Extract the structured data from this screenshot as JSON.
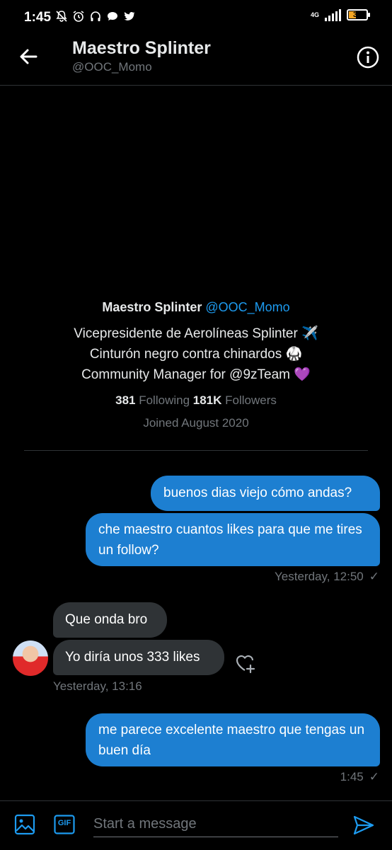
{
  "status_bar": {
    "time": "1:45",
    "network": "4G",
    "battery": "39",
    "icons": [
      "mute-icon",
      "alarm-icon",
      "headphones-icon",
      "chat-bubble-icon",
      "twitter-icon"
    ]
  },
  "header": {
    "name": "Maestro Splinter",
    "handle": "@OOC_Momo"
  },
  "profile": {
    "name": "Maestro Splinter",
    "handle": "@OOC_Momo",
    "bio": [
      "Vicepresidente de Aerolíneas Splinter ✈️",
      "Cinturón negro contra chinardos 🥋",
      "Community Manager for @9zTeam 💜"
    ],
    "following_count": "381",
    "following_label": "Following",
    "followers_count": "181K",
    "followers_label": "Followers",
    "joined": "Joined August 2020"
  },
  "messages": [
    {
      "text": "buenos dias viejo cómo andas?",
      "dir": "out"
    },
    {
      "text": "che maestro cuantos likes para que me tires un follow?",
      "dir": "out"
    },
    {
      "text": "Que onda bro",
      "dir": "in"
    },
    {
      "text": "Yo diría unos 333 likes",
      "dir": "in"
    },
    {
      "text": "me parece excelente maestro que tengas un buen día",
      "dir": "out"
    }
  ],
  "timestamps": {
    "group1": "Yesterday, 12:50",
    "group2": "Yesterday, 13:16",
    "group3": "1:45"
  },
  "composer": {
    "placeholder": "Start a message",
    "gif_label": "GIF"
  },
  "colors": {
    "accent": "#1d9bf0",
    "outgoing_bubble": "#1d7fd1",
    "incoming_bubble": "#2f3336",
    "battery": "#f5a623"
  }
}
